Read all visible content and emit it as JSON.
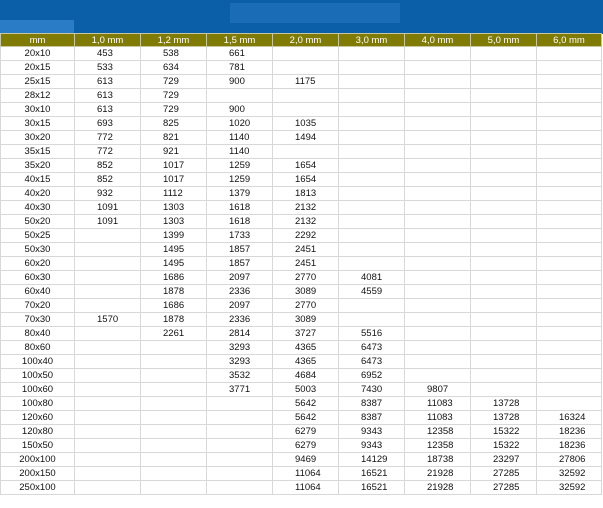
{
  "header": {
    "columns": [
      "mm",
      "1,0 mm",
      "1,2 mm",
      "1,5 mm",
      "2,0 mm",
      "3,0 mm",
      "4,0 mm",
      "5,0 mm",
      "6,0 mm"
    ]
  },
  "rows": [
    [
      "20x10",
      "453",
      "538",
      "661",
      "",
      "",
      "",
      "",
      ""
    ],
    [
      "20x15",
      "533",
      "634",
      "781",
      "",
      "",
      "",
      "",
      ""
    ],
    [
      "25x15",
      "613",
      "729",
      "900",
      "1175",
      "",
      "",
      "",
      ""
    ],
    [
      "28x12",
      "613",
      "729",
      "",
      "",
      "",
      "",
      "",
      ""
    ],
    [
      "30x10",
      "613",
      "729",
      "900",
      "",
      "",
      "",
      "",
      ""
    ],
    [
      "30x15",
      "693",
      "825",
      "1020",
      "1035",
      "",
      "",
      "",
      ""
    ],
    [
      "30x20",
      "772",
      "821",
      "1140",
      "1494",
      "",
      "",
      "",
      ""
    ],
    [
      "35x15",
      "772",
      "921",
      "1140",
      "",
      "",
      "",
      "",
      ""
    ],
    [
      "35x20",
      "852",
      "1017",
      "1259",
      "1654",
      "",
      "",
      "",
      ""
    ],
    [
      "40x15",
      "852",
      "1017",
      "1259",
      "1654",
      "",
      "",
      "",
      ""
    ],
    [
      "40x20",
      "932",
      "1112",
      "1379",
      "1813",
      "",
      "",
      "",
      ""
    ],
    [
      "40x30",
      "1091",
      "1303",
      "1618",
      "2132",
      "",
      "",
      "",
      ""
    ],
    [
      "50x20",
      "1091",
      "1303",
      "1618",
      "2132",
      "",
      "",
      "",
      ""
    ],
    [
      "50x25",
      "",
      "1399",
      "1733",
      "2292",
      "",
      "",
      "",
      ""
    ],
    [
      "50x30",
      "",
      "1495",
      "1857",
      "2451",
      "",
      "",
      "",
      ""
    ],
    [
      "60x20",
      "",
      "1495",
      "1857",
      "2451",
      "",
      "",
      "",
      ""
    ],
    [
      "60x30",
      "",
      "1686",
      "2097",
      "2770",
      "4081",
      "",
      "",
      ""
    ],
    [
      "60x40",
      "",
      "1878",
      "2336",
      "3089",
      "4559",
      "",
      "",
      ""
    ],
    [
      "70x20",
      "",
      "1686",
      "2097",
      "2770",
      "",
      "",
      "",
      ""
    ],
    [
      "70x30",
      "1570",
      "1878",
      "2336",
      "3089",
      "",
      "",
      "",
      ""
    ],
    [
      "80x40",
      "",
      "2261",
      "2814",
      "3727",
      "5516",
      "",
      "",
      ""
    ],
    [
      "80x60",
      "",
      "",
      "3293",
      "4365",
      "6473",
      "",
      "",
      ""
    ],
    [
      "100x40",
      "",
      "",
      "3293",
      "4365",
      "6473",
      "",
      "",
      ""
    ],
    [
      "100x50",
      "",
      "",
      "3532",
      "4684",
      "6952",
      "",
      "",
      ""
    ],
    [
      "100x60",
      "",
      "",
      "3771",
      "5003",
      "7430",
      "9807",
      "",
      ""
    ],
    [
      "100x80",
      "",
      "",
      "",
      "5642",
      "8387",
      "11083",
      "13728",
      ""
    ],
    [
      "120x60",
      "",
      "",
      "",
      "5642",
      "8387",
      "11083",
      "13728",
      "16324"
    ],
    [
      "120x80",
      "",
      "",
      "",
      "6279",
      "9343",
      "12358",
      "15322",
      "18236"
    ],
    [
      "150x50",
      "",
      "",
      "",
      "6279",
      "9343",
      "12358",
      "15322",
      "18236"
    ],
    [
      "200x100",
      "",
      "",
      "",
      "9469",
      "14129",
      "18738",
      "23297",
      "27806"
    ],
    [
      "200x150",
      "",
      "",
      "",
      "11064",
      "16521",
      "21928",
      "27285",
      "32592"
    ],
    [
      "250x100",
      "",
      "",
      "",
      "11064",
      "16521",
      "21928",
      "27285",
      "32592"
    ]
  ],
  "colors": {
    "banner": "#0b5ea8",
    "header_bg": "#7f7b05",
    "header_text": "#ffffff"
  }
}
